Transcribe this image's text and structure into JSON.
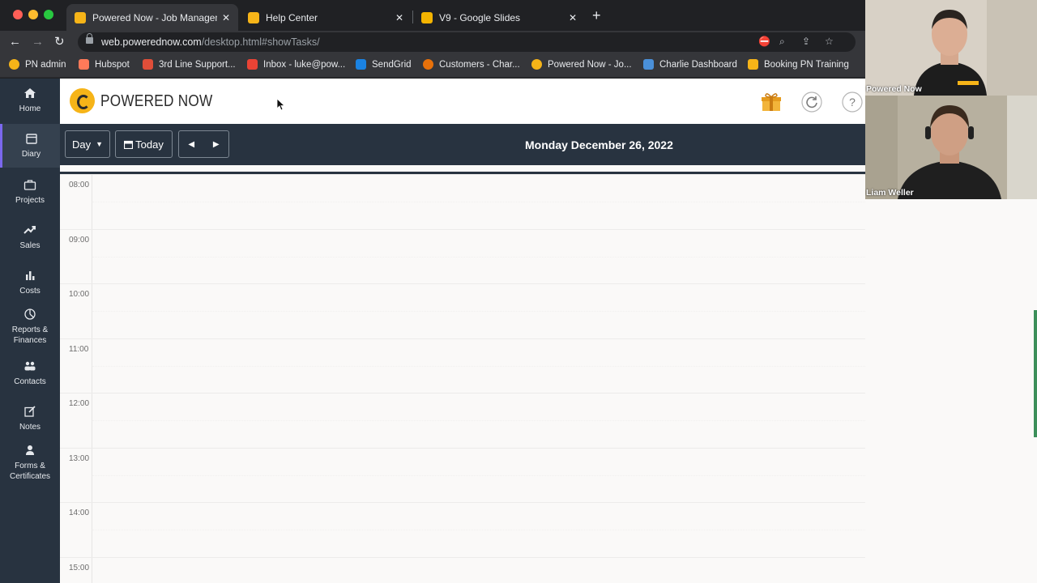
{
  "browser": {
    "tabs": [
      {
        "title": "Powered Now - Job Manageme",
        "favicon_color": "#f6b418",
        "active": true
      },
      {
        "title": "Help Center",
        "favicon_color": "#f6b418",
        "active": false
      },
      {
        "title": "V9 - Google Slides",
        "favicon_color": "#f4b400",
        "active": false
      }
    ],
    "url_host": "web.powerednow.com",
    "url_path": "/desktop.html#showTasks/",
    "bookmarks": [
      {
        "label": "PN admin",
        "color": "#f6b418"
      },
      {
        "label": "Hubspot",
        "color": "#ff7a59"
      },
      {
        "label": "3rd Line Support...",
        "color": "#e04e39"
      },
      {
        "label": "Inbox - luke@pow...",
        "color": "#ea4335"
      },
      {
        "label": "SendGrid",
        "color": "#1a82e2"
      },
      {
        "label": "Customers - Char...",
        "color": "#e8710a"
      },
      {
        "label": "Powered Now - Jo...",
        "color": "#f6b418"
      },
      {
        "label": "Charlie Dashboard",
        "color": "#4a90d9"
      },
      {
        "label": "Booking PN Training",
        "color": "#f6b418"
      }
    ]
  },
  "sidebar": {
    "items": [
      {
        "label": "Home",
        "icon": "home-icon"
      },
      {
        "label": "Diary",
        "icon": "calendar-icon",
        "active": true
      },
      {
        "label": "Projects",
        "icon": "briefcase-icon"
      },
      {
        "label": "Sales",
        "icon": "trend-up-icon"
      },
      {
        "label": "Costs",
        "icon": "bar-chart-icon"
      },
      {
        "label": "Reports &",
        "label2": "Finances",
        "icon": "pie-chart-icon"
      },
      {
        "label": "Contacts",
        "icon": "people-icon"
      },
      {
        "label": "Notes",
        "icon": "edit-note-icon"
      },
      {
        "label": "Forms &",
        "label2": "Certificates",
        "icon": "person-badge-icon"
      }
    ]
  },
  "header": {
    "brand": "POWERED NOW",
    "icons": [
      "gift-icon",
      "refresh-icon",
      "help-icon"
    ]
  },
  "diary": {
    "view_label": "Day",
    "today_label": "Today",
    "date": "Monday December 26, 2022",
    "hours": [
      "08:00",
      "09:00",
      "10:00",
      "11:00",
      "12:00",
      "13:00",
      "14:00",
      "15:00"
    ]
  },
  "video_call": {
    "participants": [
      {
        "name": "Powered Now"
      },
      {
        "name": "Liam Weller"
      }
    ]
  },
  "colors": {
    "sidebar": "#283340",
    "accent": "#f6b418",
    "active_indicator": "#7b68ee"
  }
}
